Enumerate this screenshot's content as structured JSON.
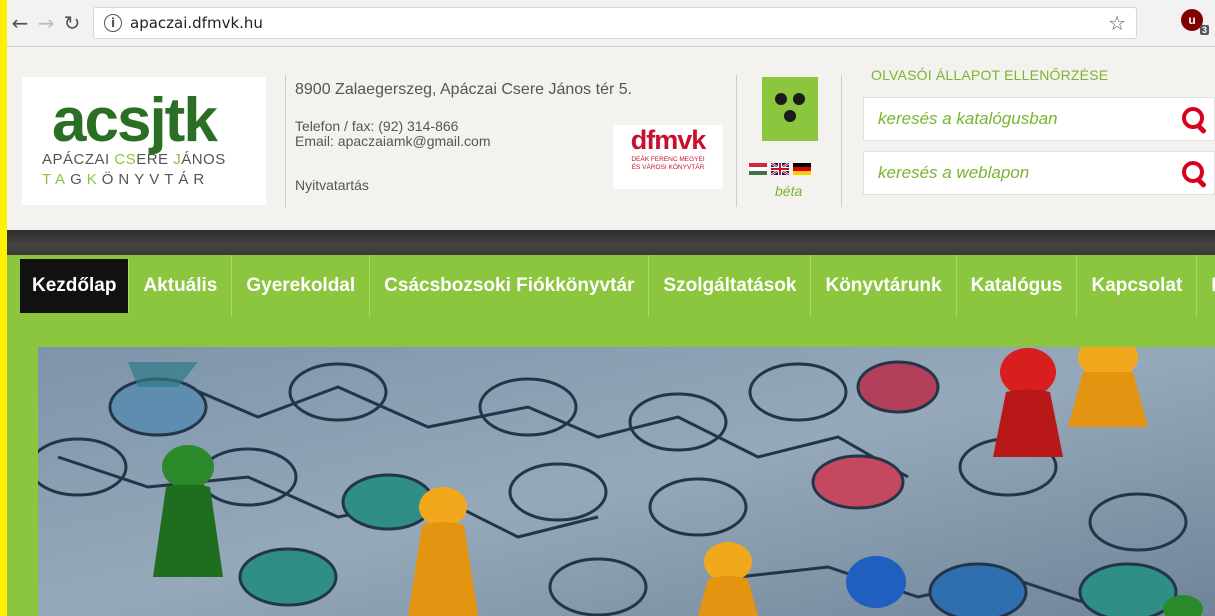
{
  "browser": {
    "url": "apaczai.dfmvk.hu",
    "ext_badge": "3",
    "ext_letter": "u"
  },
  "header": {
    "logo_mark": "acsjtk",
    "logo_line1_a": "APÁCZAI ",
    "logo_line1_b": "CS",
    "logo_line1_c": "ERE ",
    "logo_line1_d": "J",
    "logo_line1_e": "ÁNOS",
    "logo_line2_a": "TA",
    "logo_line2_b": "G",
    "logo_line2_c": "K",
    "logo_line2_d": "ÖNYVTÁR",
    "address": "8900 Zalaegerszeg, Apáczai Csere János tér 5.",
    "phone": "Telefon / fax: (92) 314-866",
    "email": "Email: apaczaiamk@gmail.com",
    "opening": "Nyitvatartás",
    "partner_mark": "dfmvk",
    "partner_sub1": "DEÁK FERENC MEGYEI",
    "partner_sub2": "ÉS VÁROSI KÖNYVTÁR",
    "beta": "béta",
    "reader_status": "OLVASÓI ÁLLAPOT ELLENŐRZÉSE",
    "search_catalog_placeholder": "keresés a katalógusban",
    "search_web_placeholder": "keresés a weblapon"
  },
  "nav": {
    "items": [
      "Kezdőlap",
      "Aktuális",
      "Gyerekoldal",
      "Csácsbozsoki Fiókkönyvtár",
      "Szolgáltatások",
      "Könyvtárunk",
      "Katalógus",
      "Kapcsolat",
      "DFMVK"
    ]
  },
  "colors": {
    "accent_green": "#8cc63f",
    "logo_green": "#2b6f24",
    "search_red": "#d8001c",
    "partner_red": "#c8102e"
  },
  "icons": [
    "back-icon",
    "forward-icon",
    "reload-icon",
    "info-icon",
    "star-icon",
    "search-icon",
    "flag-hu-icon",
    "flag-uk-icon",
    "flag-de-icon"
  ]
}
